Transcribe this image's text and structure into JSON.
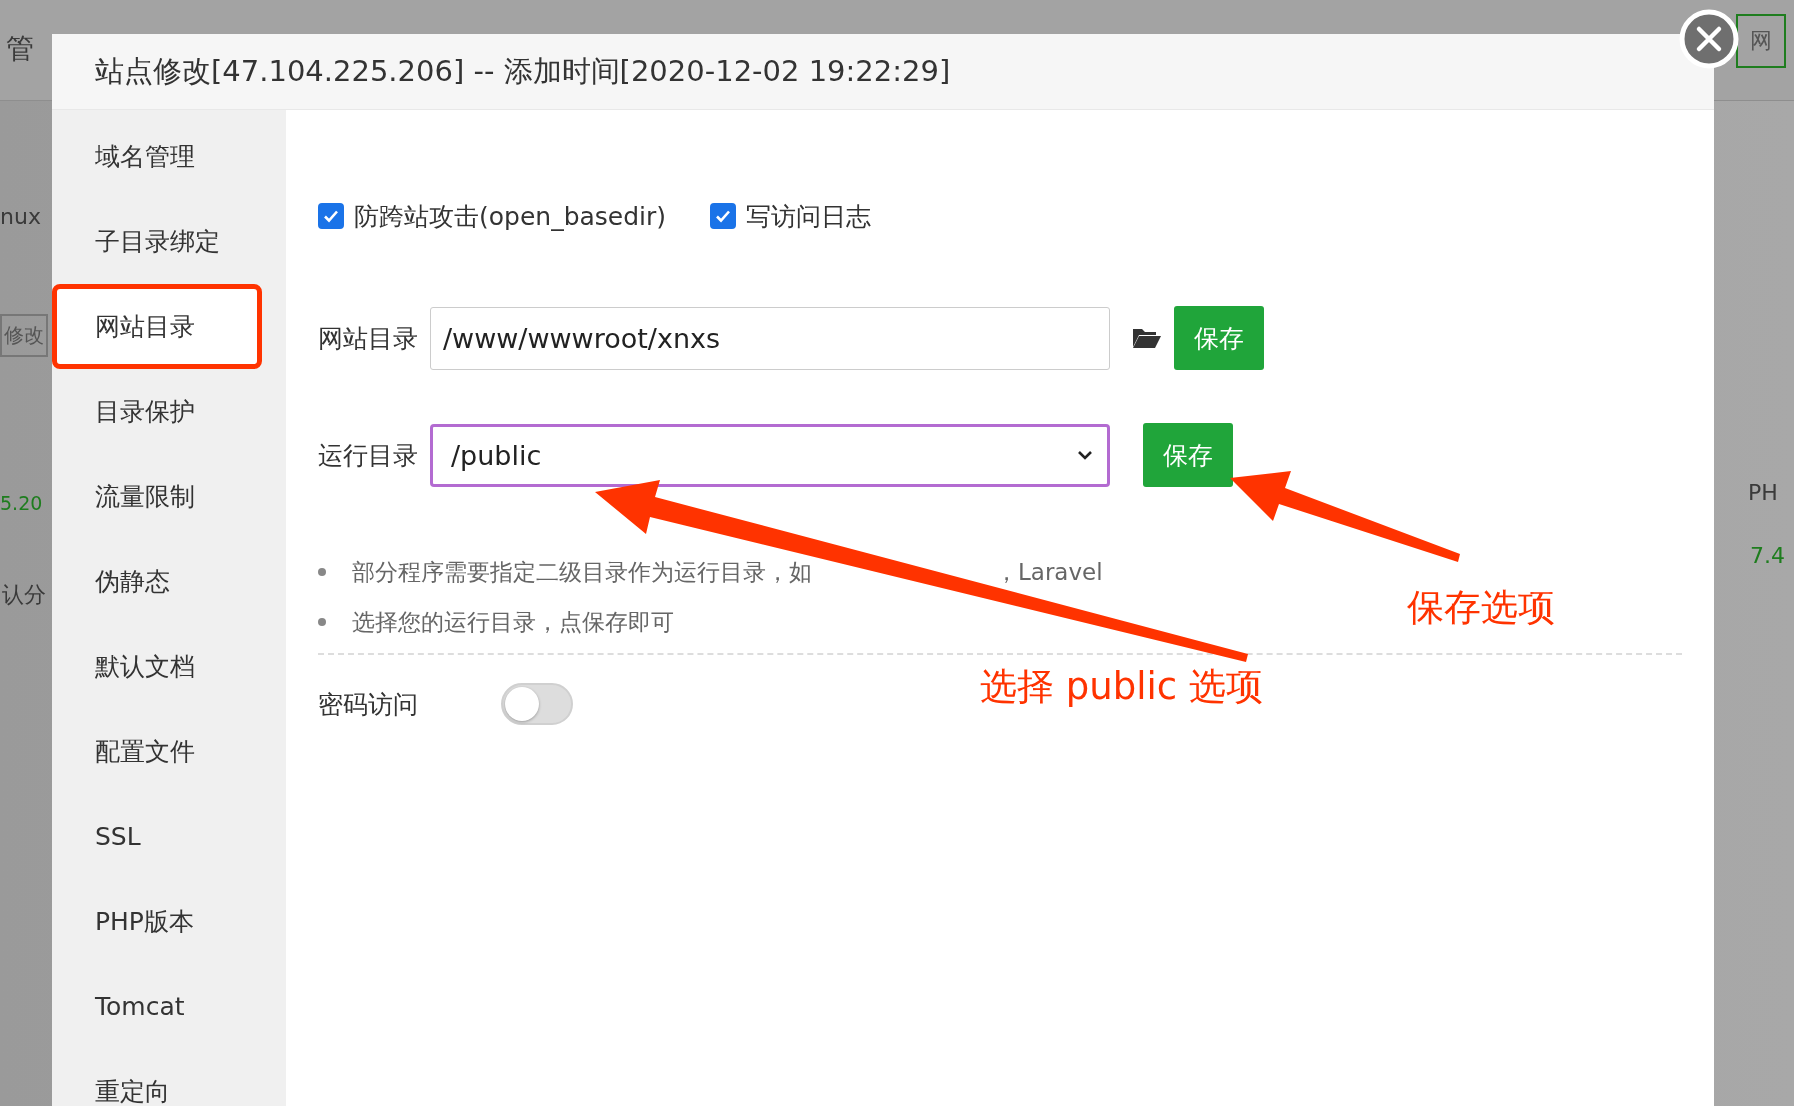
{
  "background": {
    "left": [
      {
        "text": "管",
        "kind": "text"
      },
      {
        "text": "nux",
        "kind": "text"
      },
      {
        "text": "修改",
        "kind": "button"
      },
      {
        "text": "5.20",
        "kind": "ip"
      },
      {
        "text": "认分",
        "kind": "text"
      }
    ],
    "right": [
      {
        "text": "网",
        "kind": "button"
      },
      {
        "text": "PH",
        "kind": "text"
      },
      {
        "text": "7.4",
        "kind": "ip"
      }
    ]
  },
  "dialog": {
    "title": "站点修改[47.104.225.206] -- 添加时间[2020-12-02 19:22:29]"
  },
  "sidebar": {
    "items": [
      {
        "label": "域名管理",
        "selected": false
      },
      {
        "label": "子目录绑定",
        "selected": false
      },
      {
        "label": "网站目录",
        "selected": true
      },
      {
        "label": "目录保护",
        "selected": false
      },
      {
        "label": "流量限制",
        "selected": false
      },
      {
        "label": "伪静态",
        "selected": false
      },
      {
        "label": "默认文档",
        "selected": false
      },
      {
        "label": "配置文件",
        "selected": false
      },
      {
        "label": "SSL",
        "selected": false
      },
      {
        "label": "PHP版本",
        "selected": false
      },
      {
        "label": "Tomcat",
        "selected": false
      },
      {
        "label": "重定向",
        "selected": false
      }
    ]
  },
  "options": [
    {
      "label": "防跨站攻击(open_basedir)",
      "checked": true
    },
    {
      "label": "写访问日志",
      "checked": true
    }
  ],
  "site_dir": {
    "label": "网站目录",
    "value": "/www/wwwroot/xnxs",
    "button": "保存"
  },
  "run_dir": {
    "label": "运行目录",
    "value": "/public",
    "button": "保存"
  },
  "hints": [
    {
      "parts": [
        "部分程序需要指定二级目录作为运行目录，如",
        "，Laravel"
      ]
    },
    {
      "parts": [
        "选择您的运行目录，点保存即可"
      ]
    }
  ],
  "password_access": {
    "label": "密码访问",
    "on": false
  },
  "annotations": [
    "保存选项",
    "选择 public 选项"
  ]
}
